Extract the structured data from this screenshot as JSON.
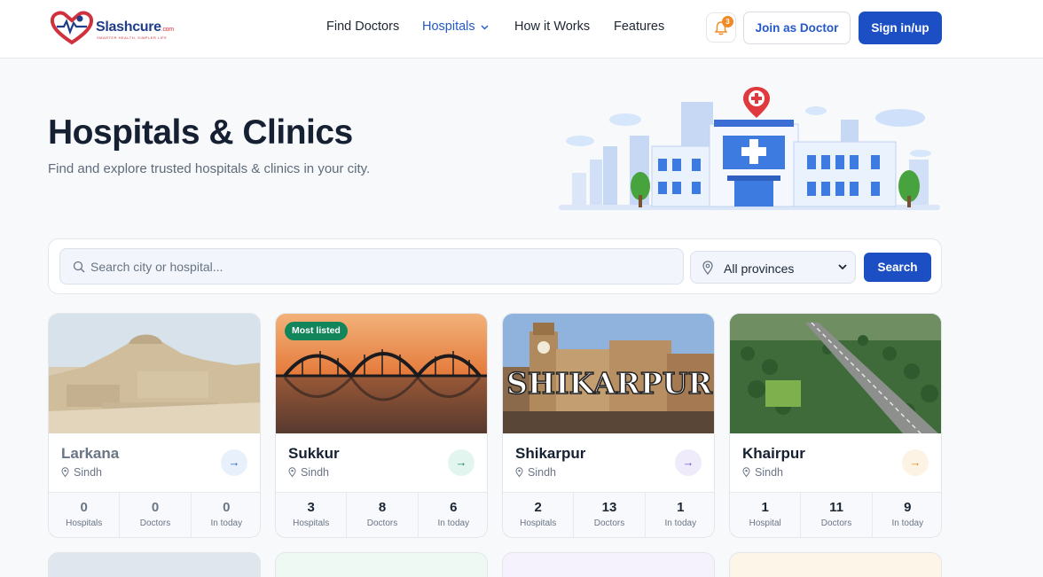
{
  "brand": {
    "name": "Slashcure",
    "tld": ".com",
    "tagline": "SMARTER HEALTH, SIMPLER LIFE"
  },
  "nav": {
    "links": [
      "Find Doctors",
      "Hospitals",
      "How it Works",
      "Features"
    ],
    "active_link": "Hospitals",
    "notification_count": "3",
    "join_label": "Join as Doctor",
    "signin_label": "Sign in/up"
  },
  "hero": {
    "title": "Hospitals & Clinics",
    "subtitle": "Find and explore trusted hospitals & clinics in your city."
  },
  "search": {
    "placeholder": "Search city or hospital...",
    "province_selected": "All provinces",
    "button_label": "Search"
  },
  "cities": [
    {
      "name": "Larkana",
      "province": "Sindh",
      "badge": "",
      "hospitals": "0",
      "hospitals_label": "Hospitals",
      "doctors": "0",
      "doctors_label": "Doctors",
      "in_today": "0",
      "in_today_label": "In today",
      "accent": "#e8f0fc"
    },
    {
      "name": "Sukkur",
      "province": "Sindh",
      "badge": "Most listed",
      "hospitals": "3",
      "hospitals_label": "Hospitals",
      "doctors": "8",
      "doctors_label": "Doctors",
      "in_today": "6",
      "in_today_label": "In today",
      "accent": "#e3f5ef"
    },
    {
      "name": "Shikarpur",
      "province": "Sindh",
      "badge": "",
      "image_text": "SHIKARPUR",
      "hospitals": "2",
      "hospitals_label": "Hospitals",
      "doctors": "13",
      "doctors_label": "Doctors",
      "in_today": "1",
      "in_today_label": "In today",
      "accent": "#efebfb"
    },
    {
      "name": "Khairpur",
      "province": "Sindh",
      "badge": "",
      "hospitals": "1",
      "hospitals_label": "Hospital",
      "doctors": "11",
      "doctors_label": "Doctors",
      "in_today": "9",
      "in_today_label": "In today",
      "accent": "#fdf3e4"
    }
  ],
  "colors": {
    "primary": "#1d4fc4",
    "badge_green": "#12865a",
    "notification": "#f08a24",
    "heading": "#152033"
  }
}
